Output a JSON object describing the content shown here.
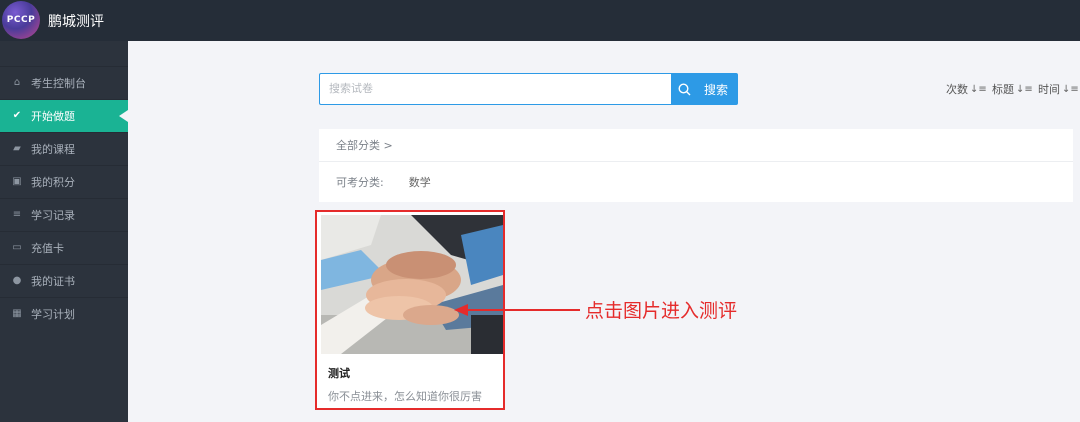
{
  "header": {
    "logo_text": "PCCP",
    "brand": "鹏城测评"
  },
  "sidebar": {
    "items": [
      {
        "label": "考生控制台",
        "icon": "home-icon",
        "active": false
      },
      {
        "label": "开始做题",
        "icon": "check-circle-icon",
        "active": true
      },
      {
        "label": "我的课程",
        "icon": "book-icon",
        "active": false
      },
      {
        "label": "我的积分",
        "icon": "gift-icon",
        "active": false
      },
      {
        "label": "学习记录",
        "icon": "list-icon",
        "active": false
      },
      {
        "label": "充值卡",
        "icon": "credit-card-icon",
        "active": false
      },
      {
        "label": "我的证书",
        "icon": "certificate-icon",
        "active": false
      },
      {
        "label": "学习计划",
        "icon": "calendar-icon",
        "active": false
      }
    ]
  },
  "search": {
    "placeholder": "搜索试卷",
    "button_label": "搜索"
  },
  "sort": {
    "count": "次数",
    "title": "标题",
    "time": "时间"
  },
  "filter": {
    "all_categories": "全部分类 >",
    "available_label": "可考分类:",
    "categories": [
      "数学"
    ]
  },
  "card": {
    "title": "测试",
    "description": "你不点进来，怎么知道你很厉害"
  },
  "annotation": {
    "text": "点击图片进入测评",
    "color": "#e52b2b"
  },
  "colors": {
    "accent": "#1ab394",
    "primary": "#2d9ae6",
    "sidebar_bg": "#2c333d",
    "topbar_bg": "#252d38"
  }
}
